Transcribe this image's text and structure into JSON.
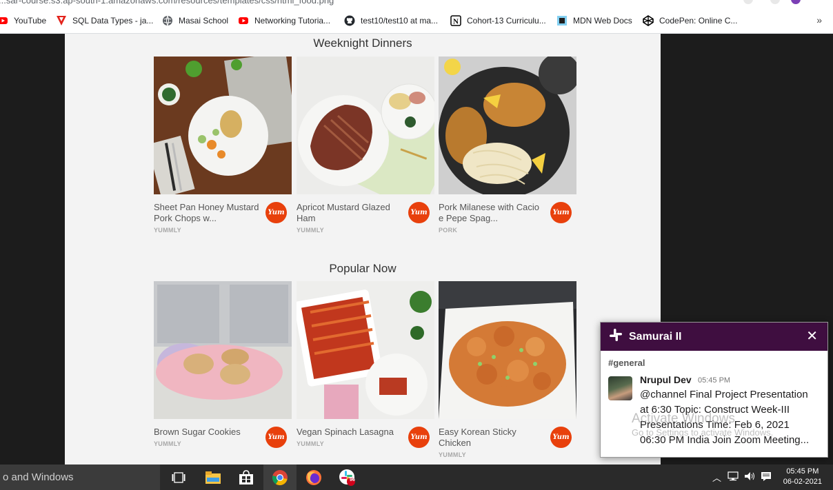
{
  "browser": {
    "url": "...sar-course.s3.ap-south-1.amazonaws.com/resources/templates/css/html_food.png",
    "bookmarks": [
      {
        "label": "YouTube",
        "icon": "youtube-icon"
      },
      {
        "label": "SQL Data Types - ja...",
        "icon": "sql-icon"
      },
      {
        "label": "Masai School",
        "icon": "globe-icon"
      },
      {
        "label": "Networking Tutoria...",
        "icon": "youtube-icon"
      },
      {
        "label": "test10/test10 at ma...",
        "icon": "github-icon"
      },
      {
        "label": "Cohort-13 Curriculu...",
        "icon": "notion-icon"
      },
      {
        "label": "MDN Web Docs",
        "icon": "mdn-icon"
      },
      {
        "label": "CodePen: Online C...",
        "icon": "codepen-icon"
      }
    ],
    "more": "»"
  },
  "sections": [
    {
      "title": "Weeknight Dinners",
      "cards": [
        {
          "title": "Sheet Pan Honey Mustard Pork Chops w...",
          "source": "YUMMLY"
        },
        {
          "title": "Apricot Mustard Glazed Ham",
          "source": "YUMMLY"
        },
        {
          "title": "Pork Milanese with Cacio e Pepe Spag...",
          "source": "PORK"
        }
      ]
    },
    {
      "title": "Popular Now",
      "cards": [
        {
          "title": "Brown Sugar Cookies",
          "source": "YUMMLY"
        },
        {
          "title": "Vegan Spinach Lasagna",
          "source": "YUMMLY"
        },
        {
          "title": "Easy Korean Sticky Chicken",
          "source": "YUMMLY"
        }
      ]
    }
  ],
  "badge": "Yum",
  "notification": {
    "app": "Samurai II",
    "channel": "#general",
    "sender": "Nrupul Dev",
    "time": "05:45 PM",
    "lines": [
      "@channel Final Project Presentation",
      "at 6:30 Topic: Construct Week-III",
      "Presentations Time: Feb 6, 2021",
      "06:30 PM India Join Zoom Meeting..."
    ]
  },
  "watermark": {
    "line1": "Activate Windows",
    "line2": "Go to Settings to activate Windows."
  },
  "taskbar": {
    "search": "o and Windows",
    "clock_time": "05:45 PM",
    "clock_date": "06-02-2021",
    "badge_count": "96"
  },
  "colors": {
    "yum": "#e8400c",
    "slack_header": "#3f0e40"
  }
}
